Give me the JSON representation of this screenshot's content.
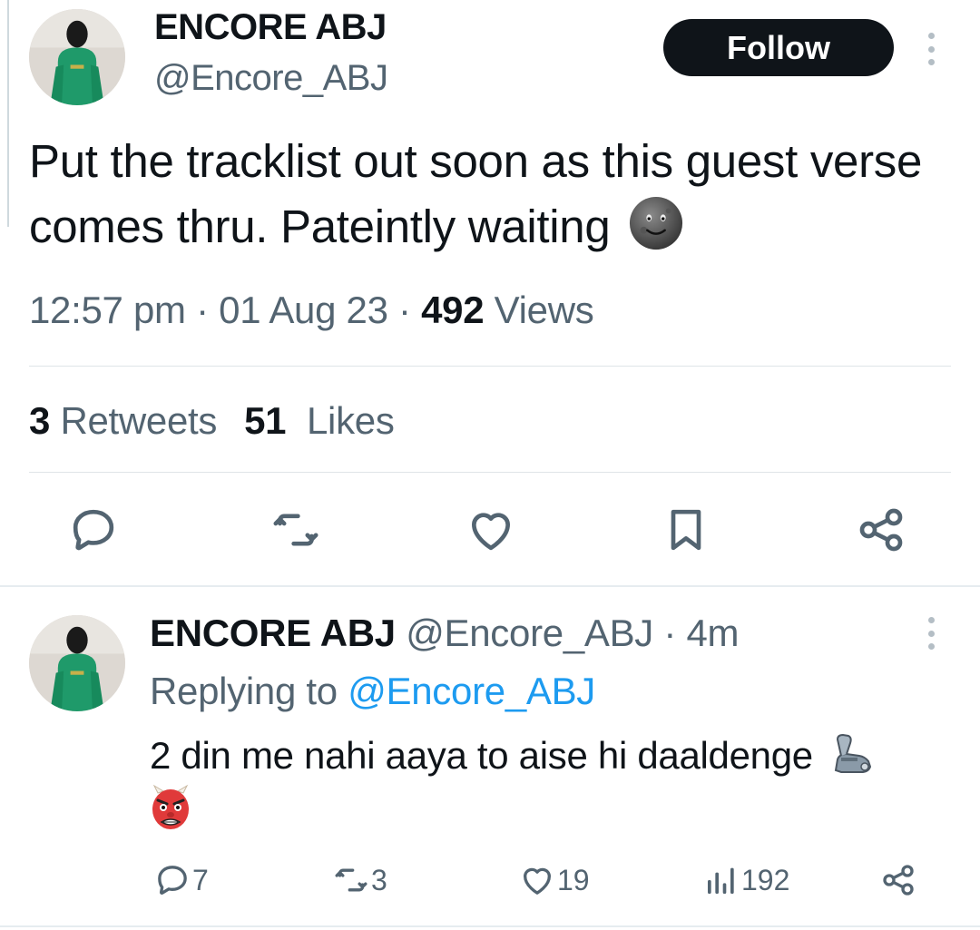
{
  "main_tweet": {
    "display_name": "ENCORE ABJ",
    "handle": "@Encore_ABJ",
    "follow_label": "Follow",
    "text": "Put the tracklist out soon as this guest verse comes thru. Pateintly waiting",
    "emoji": "new-moon-face",
    "time": "12:57 pm",
    "date": "01 Aug 23",
    "views_count": "492",
    "views_label": "Views",
    "retweets_count": "3",
    "retweets_label": "Retweets",
    "likes_count": "51",
    "likes_label": "Likes",
    "actions": [
      "reply-icon",
      "retweet-icon",
      "like-icon",
      "bookmark-icon",
      "share-icon"
    ]
  },
  "reply": {
    "display_name": "ENCORE ABJ",
    "handle": "@Encore_ABJ",
    "time_ago": "4m",
    "replying_prefix": "Replying to",
    "replying_handle": "@Encore_ABJ",
    "text": "2 din me nahi aaya to aise hi daaldenge",
    "emojis": [
      "mechanical-arm",
      "goblin"
    ],
    "replies": "7",
    "retweets": "3",
    "likes": "19",
    "views": "192"
  },
  "colors": {
    "text": "#0f1419",
    "secondary": "#536471",
    "link": "#1d9bf0",
    "follow_bg": "#0f1419"
  }
}
